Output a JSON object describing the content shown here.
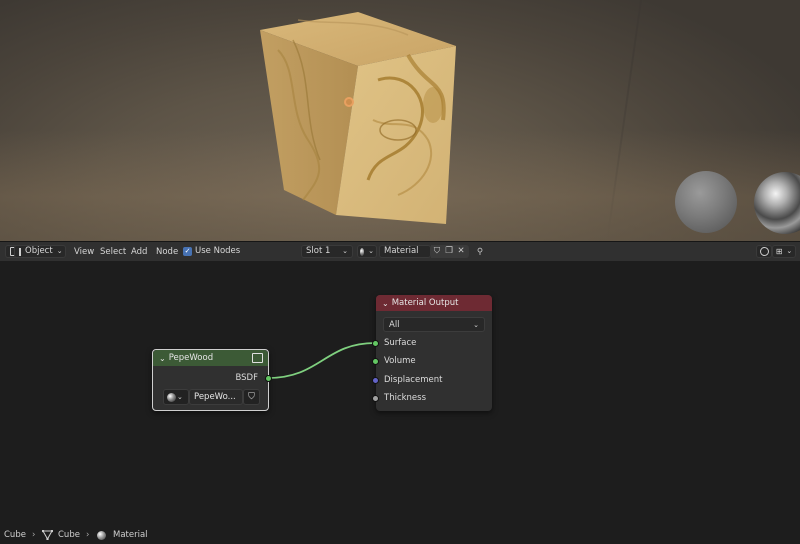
{
  "header": {
    "mode_label": "Object",
    "menus": [
      "View",
      "Select",
      "Add",
      "Node"
    ],
    "use_nodes_label": "Use Nodes",
    "use_nodes_checked": true,
    "slot_label": "Slot 1",
    "material_name": "Material"
  },
  "breadcrumb": {
    "object": "Cube",
    "mesh": "Cube",
    "material": "Material"
  },
  "nodes": {
    "group": {
      "title": "PepeWood",
      "output_label": "BSDF",
      "datablock": "PepeWo..."
    },
    "material_output": {
      "title": "Material Output",
      "target": "All",
      "inputs": [
        "Surface",
        "Volume",
        "Displacement",
        "Thickness"
      ]
    }
  },
  "colors": {
    "group_header": "#3c5a36",
    "output_header": "#6e2a33",
    "shader_socket": "#63c763",
    "vector_socket": "#6363c7",
    "float_socket": "#a1a1a1",
    "accent": "#4772b3"
  }
}
